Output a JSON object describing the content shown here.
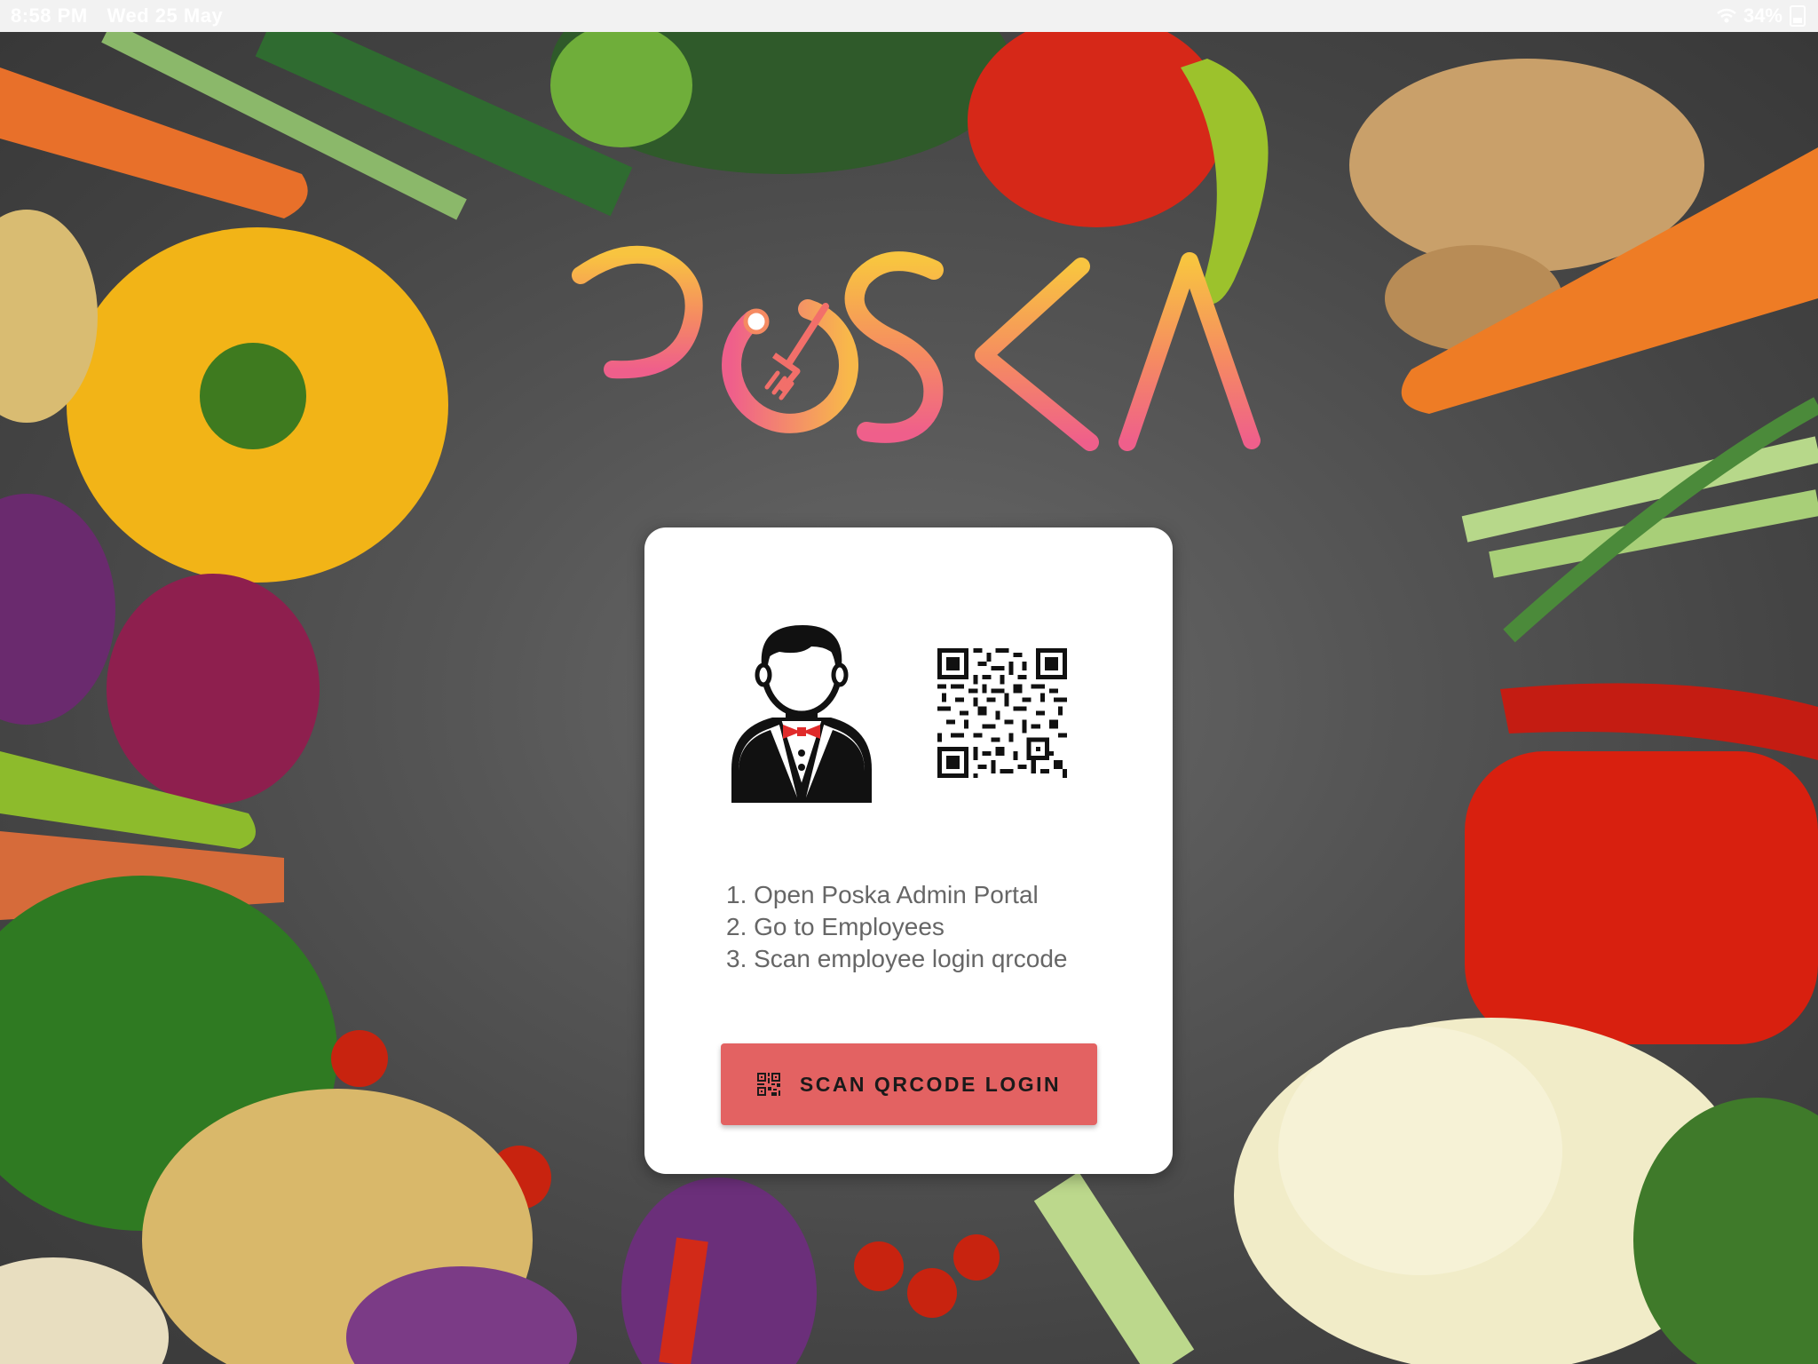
{
  "status_bar": {
    "time": "8:58 PM",
    "date": "Wed 25 May",
    "battery": "34%",
    "icons": [
      "wifi-icon",
      "battery-icon"
    ]
  },
  "logo": {
    "text": "POSKA",
    "icon": "fork-icon",
    "colors": [
      "#f8c440",
      "#f58a62",
      "#ef5f8b"
    ]
  },
  "card": {
    "icons": [
      "waiter-icon",
      "qrcode-icon"
    ],
    "instructions": [
      "1. Open Poska Admin Portal",
      "2. Go to Employees",
      "3. Scan employee login qrcode"
    ],
    "scan_button": {
      "label": "SCAN QRCODE LOGIN",
      "icon": "qrcode-icon",
      "color": "#e36262"
    }
  }
}
